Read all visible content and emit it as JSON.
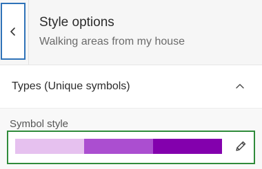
{
  "header": {
    "title": "Style options",
    "subtitle": "Walking areas from my house",
    "back_icon": "chevron-left-icon"
  },
  "section": {
    "title": "Types (Unique symbols)",
    "toggle_icon": "chevron-up-icon",
    "expanded": true
  },
  "symbol_style": {
    "label": "Symbol style",
    "ramp_colors": [
      "#e6c1ef",
      "#ab4ed0",
      "#8300ad"
    ],
    "edit_icon": "pencil-icon"
  },
  "colors": {
    "focus_outline": "#2e72b8",
    "highlight_outline": "#2e8b3a"
  }
}
